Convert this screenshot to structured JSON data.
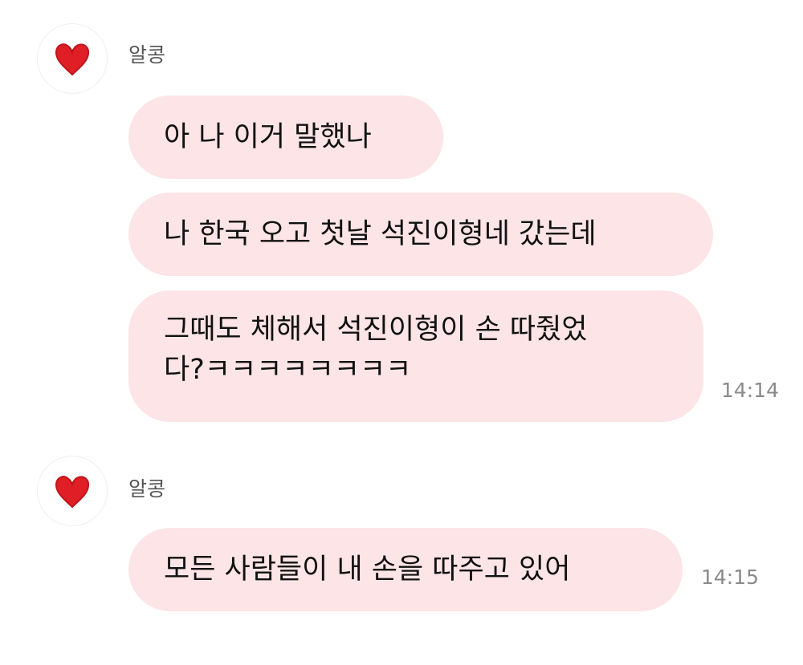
{
  "chat": {
    "accent_color": "#fde4e6",
    "groups": [
      {
        "sender": "알콩",
        "avatar_icon": "red-heart-icon",
        "messages": [
          {
            "lines": [
              "아 나 이거 말했나"
            ]
          },
          {
            "lines": [
              "나 한국 오고 첫날 석진이형네 갔는데"
            ]
          },
          {
            "lines": [
              "그때도 체해서 석진이형이 손 따줬었",
              "다?ㅋㅋㅋㅋㅋㅋㅋㅋ"
            ]
          }
        ],
        "time": "14:14"
      },
      {
        "sender": "알콩",
        "avatar_icon": "red-heart-icon",
        "messages": [
          {
            "lines": [
              "모든 사람들이 내 손을 따주고 있어"
            ]
          }
        ],
        "time": "14:15"
      }
    ]
  }
}
